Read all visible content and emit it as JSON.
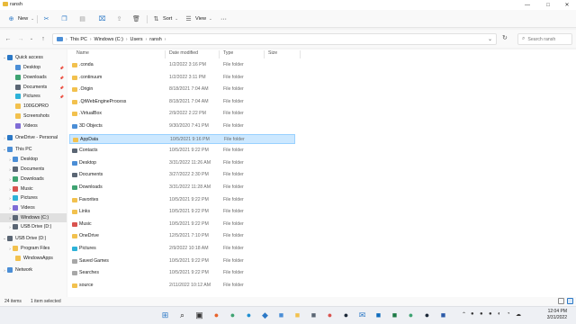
{
  "window": {
    "title": "ransh",
    "minimize_glyph": "—",
    "maximize_glyph": "□",
    "close_glyph": "✕"
  },
  "commandbar": {
    "new_label": "New",
    "sort_label": "Sort",
    "view_label": "View",
    "more_glyph": "···"
  },
  "address": {
    "crumbs": [
      "This PC",
      "Windows (C:)",
      "Users",
      "ransh"
    ],
    "search_placeholder": "Search ransh"
  },
  "nav": {
    "items": [
      {
        "label": "Quick access",
        "chevron": "⌄",
        "icon": "star-icon",
        "color": "#2b78c6"
      },
      {
        "label": "Desktop",
        "chevron": "",
        "icon": "desktop-icon",
        "color": "#4b8ed6",
        "pinned": true
      },
      {
        "label": "Downloads",
        "chevron": "",
        "icon": "download-icon",
        "color": "#3fa372",
        "pinned": true
      },
      {
        "label": "Documents",
        "chevron": "",
        "icon": "document-icon",
        "color": "#5b6674",
        "pinned": true
      },
      {
        "label": "Pictures",
        "chevron": "",
        "icon": "pictures-icon",
        "color": "#2db2d8",
        "pinned": true
      },
      {
        "label": "100GOPRO",
        "chevron": "",
        "icon": "folder-icon",
        "color": "#f2c14e"
      },
      {
        "label": "Screenshots",
        "chevron": "",
        "icon": "folder-icon",
        "color": "#f2c14e"
      },
      {
        "label": "Videos",
        "chevron": "",
        "icon": "video-icon",
        "color": "#7f6cd6"
      },
      {
        "label": "OneDrive - Personal",
        "chevron": "›",
        "icon": "cloud-icon",
        "color": "#2b78c6"
      },
      {
        "label": "This PC",
        "chevron": "⌄",
        "icon": "computer-icon",
        "color": "#4b8ed6"
      },
      {
        "label": "Desktop",
        "chevron": "›",
        "icon": "desktop-icon",
        "color": "#4b8ed6"
      },
      {
        "label": "Documents",
        "chevron": "›",
        "icon": "document-icon",
        "color": "#5b6674"
      },
      {
        "label": "Downloads",
        "chevron": "›",
        "icon": "download-icon",
        "color": "#3fa372"
      },
      {
        "label": "Music",
        "chevron": "›",
        "icon": "music-icon",
        "color": "#d9534f"
      },
      {
        "label": "Pictures",
        "chevron": "›",
        "icon": "pictures-icon",
        "color": "#2db2d8"
      },
      {
        "label": "Videos",
        "chevron": "›",
        "icon": "video-icon",
        "color": "#7f6cd6"
      },
      {
        "label": "Windows (C:)",
        "chevron": "›",
        "icon": "drive-icon",
        "color": "#5b6674",
        "selected": true
      },
      {
        "label": "USB Drive (D:)",
        "chevron": "›",
        "icon": "usb-drive-icon",
        "color": "#5b6674"
      },
      {
        "label": "USB Drive (D:)",
        "chevron": "⌄",
        "icon": "usb-drive-icon",
        "color": "#5b6674"
      },
      {
        "label": "Program Files",
        "chevron": "›",
        "icon": "folder-icon",
        "color": "#f2c14e"
      },
      {
        "label": "WindowsApps",
        "chevron": "",
        "icon": "folder-icon",
        "color": "#f2c14e"
      },
      {
        "label": "Network",
        "chevron": "›",
        "icon": "network-icon",
        "color": "#4b8ed6"
      }
    ]
  },
  "columns": {
    "name": "Name",
    "date": "Date modified",
    "type": "Type",
    "size": "Size"
  },
  "files": [
    {
      "name": ".conda",
      "date": "1/2/2022 3:16 PM",
      "type": "File folder",
      "icon": "folder-icon",
      "color": "yellow"
    },
    {
      "name": ".continuum",
      "date": "1/2/2022 3:11 PM",
      "type": "File folder",
      "icon": "folder-icon",
      "color": "yellow"
    },
    {
      "name": ".Origin",
      "date": "8/18/2021 7:04 AM",
      "type": "File folder",
      "icon": "folder-icon",
      "color": "yellow"
    },
    {
      "name": ".QtWebEngineProcess",
      "date": "8/18/2021 7:04 AM",
      "type": "File folder",
      "icon": "folder-icon",
      "color": "yellow"
    },
    {
      "name": ".VirtualBox",
      "date": "2/9/2022 2:22 PM",
      "type": "File folder",
      "icon": "folder-icon",
      "color": "yellow"
    },
    {
      "name": "3D Objects",
      "date": "9/30/2020 7:41 PM",
      "type": "File folder",
      "icon": "3d-objects-icon",
      "color": "blue"
    },
    {
      "name": "AppData",
      "date": "10/5/2021 9:16 PM",
      "type": "File folder",
      "icon": "folder-icon",
      "color": "yellow",
      "selected": true
    },
    {
      "name": "Contacts",
      "date": "10/5/2021 9:22 PM",
      "type": "File folder",
      "icon": "contacts-icon",
      "color": "dark"
    },
    {
      "name": "Desktop",
      "date": "3/31/2022 11:26 AM",
      "type": "File folder",
      "icon": "desktop-icon",
      "color": "blue"
    },
    {
      "name": "Documents",
      "date": "3/27/2022 2:30 PM",
      "type": "File folder",
      "icon": "document-icon",
      "color": "dark"
    },
    {
      "name": "Downloads",
      "date": "3/31/2022 11:28 AM",
      "type": "File folder",
      "icon": "download-icon",
      "color": "green"
    },
    {
      "name": "Favorites",
      "date": "10/5/2021 9:22 PM",
      "type": "File folder",
      "icon": "folder-icon",
      "color": "yellow"
    },
    {
      "name": "Links",
      "date": "10/5/2021 9:22 PM",
      "type": "File folder",
      "icon": "folder-icon",
      "color": "yellow"
    },
    {
      "name": "Music",
      "date": "10/5/2021 9:22 PM",
      "type": "File folder",
      "icon": "music-icon",
      "color": "red"
    },
    {
      "name": "OneDrive",
      "date": "12/5/2021 7:10 PM",
      "type": "File folder",
      "icon": "folder-icon",
      "color": "yellow"
    },
    {
      "name": "Pictures",
      "date": "2/9/2022 10:18 AM",
      "type": "File folder",
      "icon": "pictures-icon",
      "color": "cyan"
    },
    {
      "name": "Saved Games",
      "date": "10/5/2021 9:22 PM",
      "type": "File folder",
      "icon": "saved-games-icon",
      "color": "grey"
    },
    {
      "name": "Searches",
      "date": "10/5/2021 9:22 PM",
      "type": "File folder",
      "icon": "search-icon",
      "color": "grey"
    },
    {
      "name": "source",
      "date": "2/11/2022 10:12 AM",
      "type": "File folder",
      "icon": "folder-icon",
      "color": "yellow"
    }
  ],
  "status": {
    "count": "24 items",
    "selection": "1 item selected"
  },
  "taskbar": {
    "apps": [
      {
        "icon": "windows-start-icon",
        "glyph": "⊞",
        "color": "#2b78c6"
      },
      {
        "icon": "search-icon",
        "glyph": "⌕",
        "color": "#222222"
      },
      {
        "icon": "task-view-icon",
        "glyph": "▣",
        "color": "#333333"
      },
      {
        "icon": "firefox-icon",
        "glyph": "●",
        "color": "#e8632b"
      },
      {
        "icon": "chrome-icon",
        "glyph": "●",
        "color": "#3fa372"
      },
      {
        "icon": "edge-icon",
        "glyph": "●",
        "color": "#1f8fd1"
      },
      {
        "icon": "vscode-icon",
        "glyph": "◆",
        "color": "#2b78c6"
      },
      {
        "icon": "app-icon",
        "glyph": "■",
        "color": "#4b8ed6"
      },
      {
        "icon": "file-explorer-icon",
        "glyph": "■",
        "color": "#f2c14e"
      },
      {
        "icon": "store-icon",
        "glyph": "■",
        "color": "#5b6674"
      },
      {
        "icon": "camera-icon",
        "glyph": "●",
        "color": "#d9534f"
      },
      {
        "icon": "steam-icon",
        "glyph": "●",
        "color": "#1b2838"
      },
      {
        "icon": "mail-icon",
        "glyph": "✉",
        "color": "#2b78c6"
      },
      {
        "icon": "outlook-icon",
        "glyph": "■",
        "color": "#0f6cbd"
      },
      {
        "icon": "excel-icon",
        "glyph": "■",
        "color": "#1d7a45"
      },
      {
        "icon": "xbox-icon",
        "glyph": "●",
        "color": "#3fa372"
      },
      {
        "icon": "steam-icon-2",
        "glyph": "●",
        "color": "#1b2838"
      },
      {
        "icon": "word-icon",
        "glyph": "■",
        "color": "#2b5aa8"
      }
    ],
    "tray_glyphs": [
      "⌃",
      "●",
      "●",
      "●",
      "◐",
      "◔",
      "☁",
      "▭",
      "◉",
      "◖"
    ],
    "time": "12:04 PM",
    "date": "3/31/2022"
  }
}
